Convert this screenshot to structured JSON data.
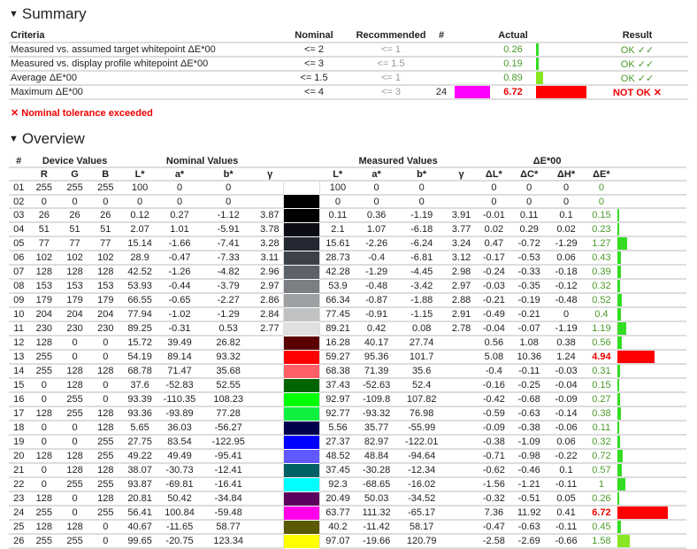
{
  "summary": {
    "title": "Summary",
    "headers": {
      "criteria": "Criteria",
      "nominal": "Nominal",
      "recommended": "Recommended",
      "num": "#",
      "actual": "Actual",
      "result": "Result"
    },
    "rows": [
      {
        "criteria": "Measured vs. assumed target whitepoint ΔE*00",
        "nominal": "<= 2",
        "recommended": "<= 1",
        "num": "",
        "swatch": "",
        "actual": "0.26",
        "result": "OK ✓✓",
        "pass": true
      },
      {
        "criteria": "Measured vs. display profile whitepoint ΔE*00",
        "nominal": "<= 3",
        "recommended": "<= 1.5",
        "num": "",
        "swatch": "",
        "actual": "0.19",
        "result": "OK ✓✓",
        "pass": true
      },
      {
        "criteria": "Average ΔE*00",
        "nominal": "<= 1.5",
        "recommended": "<= 1",
        "num": "",
        "swatch": "",
        "actual": "0.89",
        "result": "OK ✓✓",
        "pass": true
      },
      {
        "criteria": "Maximum ΔE*00",
        "nominal": "<= 4",
        "recommended": "<= 3",
        "num": "24",
        "swatch": "#ff00ff",
        "actual": "6.72",
        "result": "NOT OK ✕",
        "pass": false
      }
    ],
    "failure_note": "✕ Nominal tolerance exceeded"
  },
  "overview": {
    "title": "Overview",
    "group_headers": {
      "num": "#",
      "device": "Device Values",
      "nominal": "Nominal Values",
      "measured": "Measured Values",
      "delta": "ΔE*00"
    },
    "col_headers": [
      "R",
      "G",
      "B",
      "L*",
      "a*",
      "b*",
      "γ",
      "",
      "L*",
      "a*",
      "b*",
      "γ",
      "ΔL*",
      "ΔC*",
      "ΔH*",
      "ΔE*"
    ],
    "rows": [
      [
        "01",
        "255",
        "255",
        "255",
        "100",
        "0",
        "0",
        "",
        "#ffffff",
        "100",
        "0",
        "0",
        "",
        "0",
        "0",
        "0",
        "0"
      ],
      [
        "02",
        "0",
        "0",
        "0",
        "0",
        "0",
        "0",
        "",
        "#000000",
        "0",
        "0",
        "0",
        "",
        "0",
        "0",
        "0",
        "0"
      ],
      [
        "03",
        "26",
        "26",
        "26",
        "0.12",
        "0.27",
        "-1.12",
        "3.87",
        "#010101",
        "0.11",
        "0.36",
        "-1.19",
        "3.91",
        "-0.01",
        "0.11",
        "0.1",
        "0.15"
      ],
      [
        "04",
        "51",
        "51",
        "51",
        "2.07",
        "1.01",
        "-5.91",
        "3.78",
        "#0b0c14",
        "2.1",
        "1.07",
        "-6.18",
        "3.77",
        "0.02",
        "0.29",
        "0.02",
        "0.23"
      ],
      [
        "05",
        "77",
        "77",
        "77",
        "15.14",
        "-1.66",
        "-7.41",
        "3.28",
        "#232833",
        "15.61",
        "-2.26",
        "-6.24",
        "3.24",
        "0.47",
        "-0.72",
        "-1.29",
        "1.27"
      ],
      [
        "06",
        "102",
        "102",
        "102",
        "28.9",
        "-0.47",
        "-7.33",
        "3.11",
        "#3c4049",
        "28.73",
        "-0.4",
        "-6.81",
        "3.12",
        "-0.17",
        "-0.53",
        "0.06",
        "0.43"
      ],
      [
        "07",
        "128",
        "128",
        "128",
        "42.52",
        "-1.26",
        "-4.82",
        "2.96",
        "#5d6168",
        "42.28",
        "-1.29",
        "-4.45",
        "2.98",
        "-0.24",
        "-0.33",
        "-0.18",
        "0.39"
      ],
      [
        "08",
        "153",
        "153",
        "153",
        "53.93",
        "-0.44",
        "-3.79",
        "2.97",
        "#7b7e83",
        "53.9",
        "-0.48",
        "-3.42",
        "2.97",
        "-0.03",
        "-0.35",
        "-0.12",
        "0.32"
      ],
      [
        "09",
        "179",
        "179",
        "179",
        "66.55",
        "-0.65",
        "-2.27",
        "2.86",
        "#9ea1a4",
        "66.34",
        "-0.87",
        "-1.88",
        "2.88",
        "-0.21",
        "-0.19",
        "-0.48",
        "0.52"
      ],
      [
        "10",
        "204",
        "204",
        "204",
        "77.94",
        "-1.02",
        "-1.29",
        "2.84",
        "#bfc1c2",
        "77.45",
        "-0.91",
        "-1.15",
        "2.91",
        "-0.49",
        "-0.21",
        "0",
        "0.4"
      ],
      [
        "11",
        "230",
        "230",
        "230",
        "89.25",
        "-0.31",
        "0.53",
        "2.77",
        "#e0e0df",
        "89.21",
        "0.42",
        "0.08",
        "2.78",
        "-0.04",
        "-0.07",
        "-1.19",
        "1.19"
      ],
      [
        "12",
        "128",
        "0",
        "0",
        "15.72",
        "39.49",
        "26.82",
        "",
        "#5a0000",
        "16.28",
        "40.17",
        "27.74",
        "",
        "0.56",
        "1.08",
        "0.38",
        "0.56"
      ],
      [
        "13",
        "255",
        "0",
        "0",
        "54.19",
        "89.14",
        "93.32",
        "",
        "#ff0000",
        "59.27",
        "95.36",
        "101.7",
        "",
        "5.08",
        "10.36",
        "1.24",
        "4.94"
      ],
      [
        "14",
        "255",
        "128",
        "128",
        "68.78",
        "71.47",
        "35.68",
        "",
        "#ff6066",
        "68.38",
        "71.39",
        "35.6",
        "",
        "-0.4",
        "-0.11",
        "-0.03",
        "0.31"
      ],
      [
        "15",
        "0",
        "128",
        "0",
        "37.6",
        "-52.83",
        "52.55",
        "",
        "#006400",
        "37.43",
        "-52.63",
        "52.4",
        "",
        "-0.16",
        "-0.25",
        "-0.04",
        "0.15"
      ],
      [
        "16",
        "0",
        "255",
        "0",
        "93.39",
        "-110.35",
        "108.23",
        "",
        "#00ff00",
        "92.97",
        "-109.8",
        "107.82",
        "",
        "-0.42",
        "-0.68",
        "-0.09",
        "0.27"
      ],
      [
        "17",
        "128",
        "255",
        "128",
        "93.36",
        "-93.89",
        "77.28",
        "",
        "#10f040",
        "92.77",
        "-93.32",
        "76.98",
        "",
        "-0.59",
        "-0.63",
        "-0.14",
        "0.38"
      ],
      [
        "18",
        "0",
        "0",
        "128",
        "5.65",
        "36.03",
        "-56.27",
        "",
        "#00004f",
        "5.56",
        "35.77",
        "-55.99",
        "",
        "-0.09",
        "-0.38",
        "-0.06",
        "0.11"
      ],
      [
        "19",
        "0",
        "0",
        "255",
        "27.75",
        "83.54",
        "-122.95",
        "",
        "#0000ff",
        "27.37",
        "82.97",
        "-122.01",
        "",
        "-0.38",
        "-1.09",
        "0.06",
        "0.32"
      ],
      [
        "20",
        "128",
        "128",
        "255",
        "49.22",
        "49.49",
        "-95.41",
        "",
        "#6059ff",
        "48.52",
        "48.84",
        "-94.64",
        "",
        "-0.71",
        "-0.98",
        "-0.22",
        "0.72"
      ],
      [
        "21",
        "0",
        "128",
        "128",
        "38.07",
        "-30.73",
        "-12.41",
        "",
        "#006064",
        "37.45",
        "-30.28",
        "-12.34",
        "",
        "-0.62",
        "-0.46",
        "0.1",
        "0.57"
      ],
      [
        "22",
        "0",
        "255",
        "255",
        "93.87",
        "-69.81",
        "-16.41",
        "",
        "#00ffff",
        "92.3",
        "-68.65",
        "-16.02",
        "",
        "-1.56",
        "-1.21",
        "-0.11",
        "1"
      ],
      [
        "23",
        "128",
        "0",
        "128",
        "20.81",
        "50.42",
        "-34.84",
        "",
        "#5c005e",
        "20.49",
        "50.03",
        "-34.52",
        "",
        "-0.32",
        "-0.51",
        "0.05",
        "0.26"
      ],
      [
        "24",
        "255",
        "0",
        "255",
        "56.41",
        "100.84",
        "-59.48",
        "",
        "#ff00e8",
        "63.77",
        "111.32",
        "-65.17",
        "",
        "7.36",
        "11.92",
        "0.41",
        "6.72"
      ],
      [
        "25",
        "128",
        "128",
        "0",
        "40.67",
        "-11.65",
        "58.77",
        "",
        "#5c5a00",
        "40.2",
        "-11.42",
        "58.17",
        "",
        "-0.47",
        "-0.63",
        "-0.11",
        "0.45"
      ],
      [
        "26",
        "255",
        "255",
        "0",
        "99.65",
        "-20.75",
        "123.34",
        "",
        "#ffff00",
        "97.07",
        "-19.66",
        "120.79",
        "",
        "-2.58",
        "-2.69",
        "-0.66",
        "1.58"
      ]
    ]
  },
  "colors": {
    "ok": "#4a9a2a",
    "fail": "#ee0000",
    "bar_green": "#33dd22",
    "bar_lime": "#88e622",
    "bar_red": "#ff0000"
  }
}
